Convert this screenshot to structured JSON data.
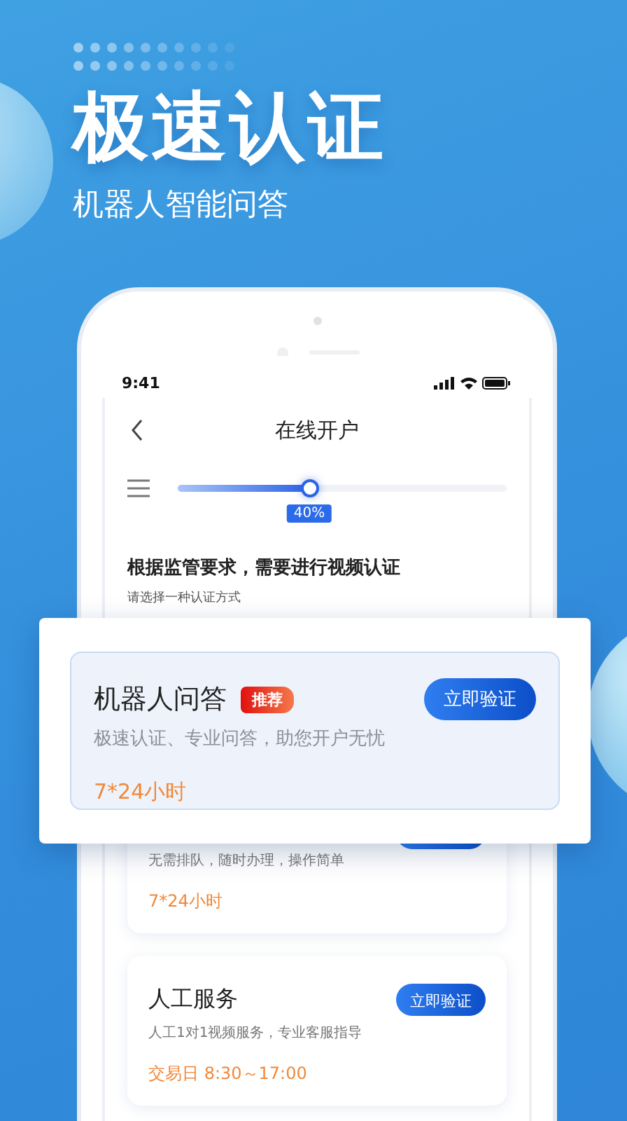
{
  "hero": {
    "title": "极速认证",
    "subtitle": "机器人智能问答"
  },
  "phone": {
    "status_bar": {
      "time": "9:41"
    },
    "nav": {
      "title": "在线开户"
    },
    "progress": {
      "level": 0.4,
      "label": "40%"
    },
    "heading": "根据监管要求，需要进行视频认证",
    "subheading": "请选择一种认证方式",
    "options": [
      {
        "kind": "partial",
        "description": "无需排队，随时办理，操作简单",
        "hours": "7*24小时"
      },
      {
        "kind": "full",
        "title": "人工服务",
        "description": "人工1对1视频服务，专业客服指导",
        "hours": "交易日 8:30～17:00",
        "button": "立即验证"
      }
    ]
  },
  "popup": {
    "title": "机器人问答",
    "badge": "推荐",
    "description": "极速认证、专业问答，助您开户无忧",
    "hours": "7*24小时",
    "button": "立即验证"
  }
}
